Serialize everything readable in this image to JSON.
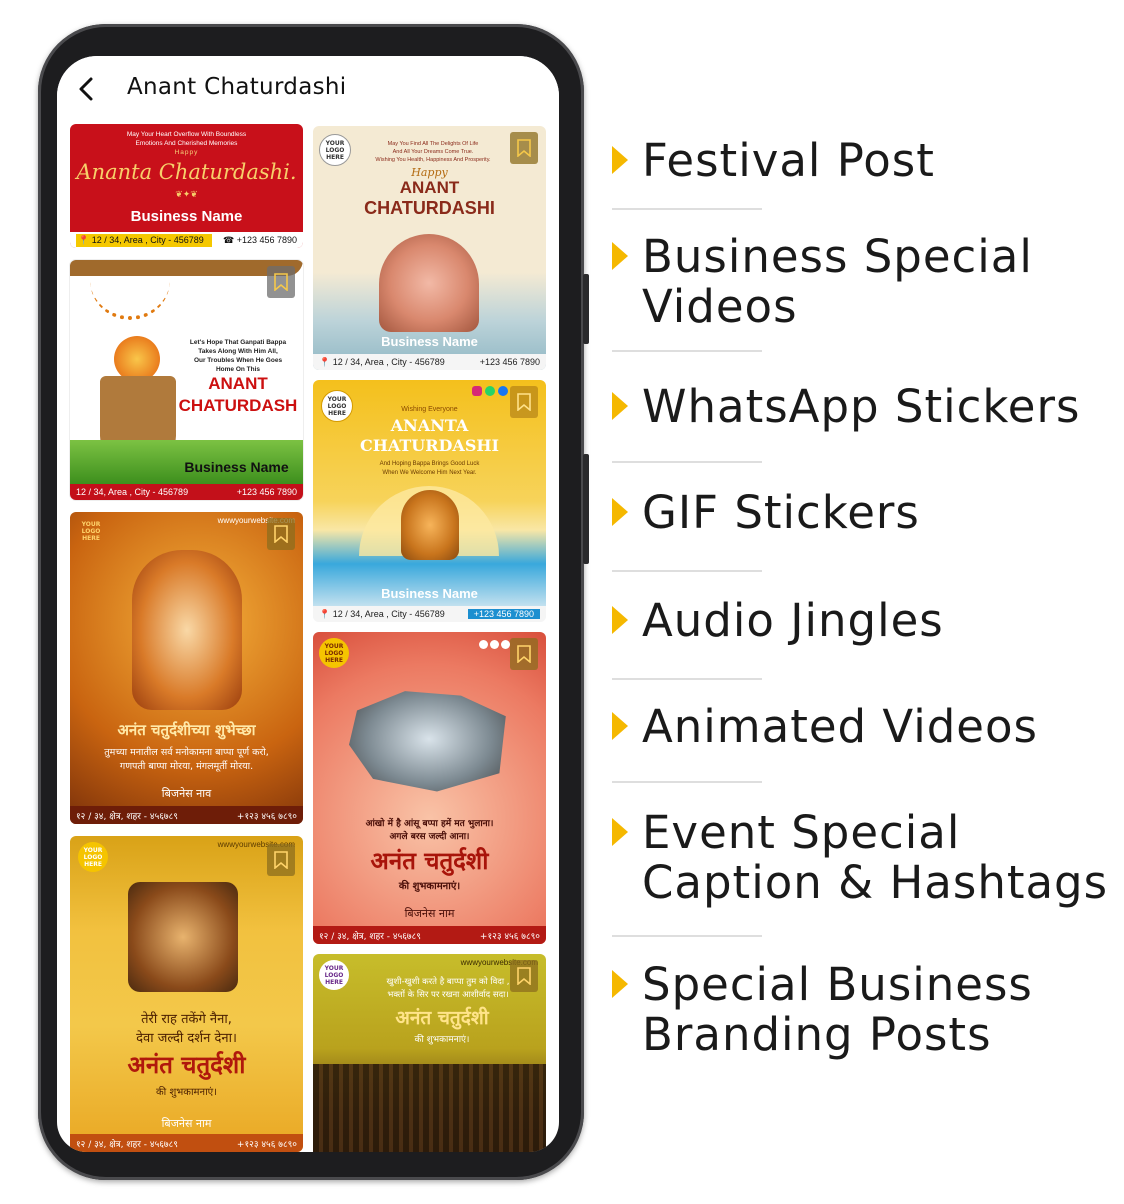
{
  "app": {
    "title": "Anant Chaturdashi"
  },
  "cards": {
    "c1": {
      "line1": "May Your Heart Overflow With Boundless",
      "line2": "Emotions And Cherished Memories",
      "happy": "Happy",
      "script": "Ananta Chaturdashi.",
      "business": "Business Name",
      "address": "12 / 34, Area , City - 456789",
      "phone": "+123 456 7890"
    },
    "c2": {
      "logo": "YOUR LOGO HERE",
      "line1": "May You Find All The Delights Of Life",
      "line2": "And All Your Dreams Come True.",
      "line3": "Wishing You Health, Happiness And Prosperity.",
      "happy": "Happy",
      "title1": "ANANT",
      "title2": "CHATURDASHI",
      "business": "Business Name",
      "address": "12 / 34, Area , City - 456789",
      "phone": "+123 456 7890"
    },
    "c3": {
      "msg1": "Let's Hope That Ganpati Bappa",
      "msg2": "Takes Along With Him All,",
      "msg3": "Our Troubles When He Goes",
      "msg4": "Home On This",
      "title1": "ANANT",
      "title2": "CHATURDASH",
      "business": "Business Name",
      "address": "12 / 34, Area , City - 456789",
      "phone": "+123 456 7890"
    },
    "c4": {
      "logo": "YOUR LOGO HERE",
      "wish": "Wishing Everyone",
      "title1": "ANANTA",
      "title2": "CHATURDASHI",
      "msg1": "And Hoping Bappa Brings Good Luck",
      "msg2": "When We Welcome Him Next Year.",
      "business": "Business Name",
      "address": "12 / 34, Area , City - 456789",
      "phone": "+123 456 7890"
    },
    "c5": {
      "logo": "YOUR LOGO HERE",
      "website": "wwwyourwebsite.com",
      "heading": "अनंत चतुर्दशीच्या शुभेच्छा",
      "line1": "तुमच्या मनातील सर्व मनोकामना बाप्पा पूर्ण करो,",
      "line2": "गणपती बाप्पा मोरया, मंगलमूर्ती मोरया.",
      "business": "बिजनेस नाव",
      "address": "१२ / ३४, क्षेत्र, शहर - ४५६७८९",
      "phone": "+१२३ ४५६ ७८९०"
    },
    "c6": {
      "logo": "YOUR LOGO HERE",
      "line1": "आंखो में है आंसू बप्पा हमें मत भुलाना।",
      "line2": "अगले बरस जल्दी आना।",
      "heading": "अनंत चतुर्दशी",
      "sub": "की शुभकामनाएं।",
      "business": "बिजनेस नाम",
      "address": "१२ / ३४, क्षेत्र, शहर - ४५६७८९",
      "phone": "+१२३ ४५६ ७८९०"
    },
    "c7": {
      "logo": "YOUR LOGO HERE",
      "website": "wwwyourwebsite.com",
      "line1": "तेरी राह तकेंगे नैना,",
      "line2": "देवा जल्दी दर्शन देना।",
      "heading": "अनंत चतुर्दशी",
      "sub": "की शुभकामनाएं।",
      "business": "बिजनेस नाम",
      "address": "१२ / ३४, क्षेत्र, शहर - ४५६७८९",
      "phone": "+१२३ ४५६ ७८९०"
    },
    "c8": {
      "logo": "YOUR LOGO HERE",
      "website": "wwwyourwebsite.com",
      "line1": "खुशी-खुशी करते है बाप्पा तुम को विदा ,",
      "line2": "भक्तों के सिर पर रखना आशीर्वाद सदा।",
      "heading": "अनंत चतुर्दशी",
      "sub": "की शुभकामनाएं।"
    }
  },
  "features": [
    {
      "label": "Festival Post"
    },
    {
      "label": "Business Special",
      "label2": "Videos"
    },
    {
      "label": "WhatsApp Stickers"
    },
    {
      "label": "GIF Stickers"
    },
    {
      "label": "Audio Jingles"
    },
    {
      "label": "Animated Videos"
    },
    {
      "label": "Event Special",
      "label2": "Caption & Hashtags"
    },
    {
      "label": "Special Business",
      "label2": "Branding Posts"
    }
  ],
  "colors": {
    "accent": "#f5b800",
    "text": "#1a1a1a",
    "phone": "#1d1d1f"
  }
}
